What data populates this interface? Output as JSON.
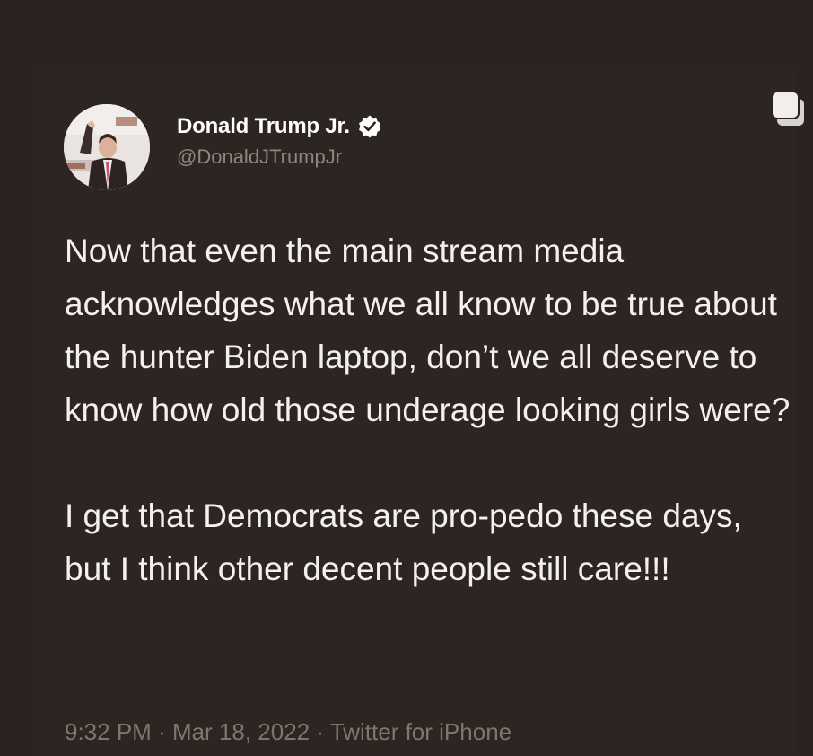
{
  "tweet": {
    "author": {
      "display_name": "Donald Trump Jr.",
      "handle": "@DonaldJTrumpJr",
      "verified_icon": "verified-badge-icon",
      "avatar": "profile-photo"
    },
    "body": "Now that even the main stream media acknowledges what we all know to be true about the hunter Biden laptop, don’t we all deserve to know how old those underage looking girls were?\n\nI get that Democrats are pro-pedo these days, but I think other decent people still care!!!",
    "meta": {
      "time": "9:32 PM",
      "date": "Mar 18, 2022",
      "source": "Twitter for iPhone",
      "separator": " · "
    }
  },
  "overlay": {
    "copy_icon": "copy-icon"
  },
  "colors": {
    "background": "#2a2320",
    "text": "#f4f0ee",
    "secondary_text": "#8e8580",
    "verified": "#ffffff"
  }
}
